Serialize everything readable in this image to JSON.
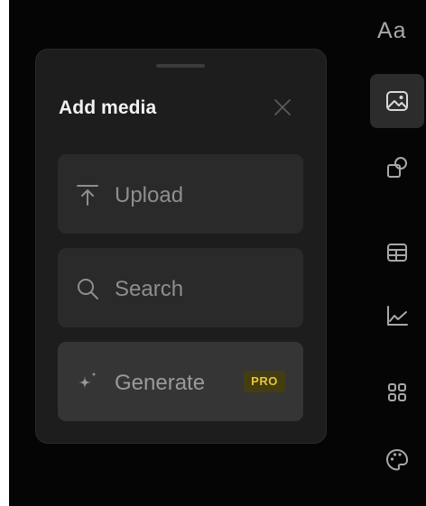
{
  "panel": {
    "title": "Add media",
    "options": [
      {
        "id": "upload",
        "label": "Upload",
        "icon": "upload-icon"
      },
      {
        "id": "search",
        "label": "Search",
        "icon": "search-icon"
      },
      {
        "id": "generate",
        "label": "Generate",
        "icon": "sparkle-icon",
        "badge": "PRO"
      }
    ]
  },
  "toolbar": {
    "text_tool_label": "Aa",
    "items": [
      "text-tool",
      "image-icon",
      "shapes-icon",
      "table-icon",
      "chart-icon",
      "grid-icon",
      "palette-icon"
    ],
    "active": "image-icon"
  },
  "colors": {
    "background": "#050505",
    "panel": "#1d1d1d",
    "option": "#2a2a2a",
    "option_highlight": "#353535",
    "badge_bg": "#453d12",
    "badge_text": "#e2c63c",
    "label": "#8e8e8e"
  }
}
